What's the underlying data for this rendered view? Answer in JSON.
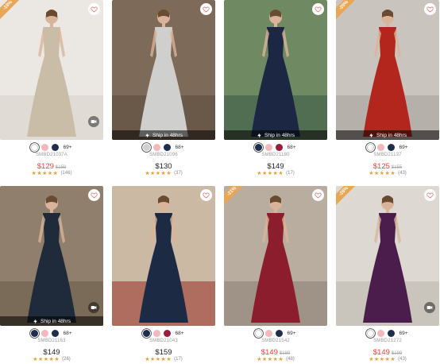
{
  "colors": {
    "sale_price": "#e8453c",
    "star": "#e6a23c",
    "badge": "#e9a657"
  },
  "products": [
    {
      "badge": "-18%",
      "ship_text": "",
      "swatches": [
        "#ffffff",
        "#f3b8bd",
        "#1e2e4d"
      ],
      "more_colors": "69+",
      "code": "SMBD21037A",
      "price": "$129",
      "original_price": "$159",
      "on_sale": true,
      "stars": "★★★★★",
      "reviews": "(146)",
      "has_video": true,
      "scene": {
        "bg": "#ebe8e3",
        "dress": "#c9bda8",
        "bg2": "#d9d4cc"
      }
    },
    {
      "badge": "",
      "ship_text": "Ship in 48hrs",
      "swatches": [
        "#d0d0d0",
        "#f3b8bd",
        "#1e2e4d"
      ],
      "more_colors": "68+",
      "code": "SMBD21096",
      "price": "$130",
      "original_price": "",
      "on_sale": false,
      "stars": "★★★★★",
      "reviews": "(37)",
      "has_video": false,
      "scene": {
        "bg": "#7d6a58",
        "dress": "#cfcfcd",
        "bg2": "#5e4e40"
      }
    },
    {
      "badge": "",
      "ship_text": "Ship in 48hrs",
      "swatches": [
        "#1e2e4d",
        "#f3b8bd",
        "#9b1c3a"
      ],
      "more_colors": "68+",
      "code": "SMBD21180",
      "price": "$149",
      "original_price": "",
      "on_sale": false,
      "stars": "★★★★★",
      "reviews": "(17)",
      "has_video": false,
      "scene": {
        "bg": "#6f8a62",
        "dress": "#1c2743",
        "bg2": "#3f5c48"
      }
    },
    {
      "badge": "-20%",
      "ship_text": "Ship in 48hrs",
      "swatches": [
        "#ffffff",
        "#f3b8bd",
        "#1e2e4d"
      ],
      "more_colors": "69+",
      "code": "SMBD21137",
      "price": "$125",
      "original_price": "$155",
      "on_sale": true,
      "stars": "★★★★★",
      "reviews": "(43)",
      "has_video": false,
      "scene": {
        "bg": "#c9c4bd",
        "dress": "#b2261e",
        "bg2": "#a8a39b"
      }
    },
    {
      "badge": "",
      "ship_text": "Ship in 48hrs",
      "swatches": [
        "#1e2e4d",
        "#f3b8bd",
        "#1e2e4d"
      ],
      "more_colors": "68+",
      "code": "SMBD21163",
      "price": "$149",
      "original_price": "",
      "on_sale": false,
      "stars": "★★★★★",
      "reviews": "(26)",
      "has_video": true,
      "scene": {
        "bg": "#8f7f6c",
        "dress": "#1f2b3a",
        "bg2": "#6c5c4b"
      }
    },
    {
      "badge": "",
      "ship_text": "",
      "swatches": [
        "#1e2e4d",
        "#f3b8bd",
        "#9b1c3a"
      ],
      "more_colors": "68+",
      "code": "SMBD21043",
      "price": "$159",
      "original_price": "",
      "on_sale": false,
      "stars": "★★★★★",
      "reviews": "(17)",
      "has_video": false,
      "scene": {
        "bg": "#cbb9a3",
        "dress": "#1d2a44",
        "bg2": "#9b3a30"
      }
    },
    {
      "badge": "-21%",
      "ship_text": "",
      "swatches": [
        "#ffffff",
        "#f3b8bd",
        "#1e2e4d"
      ],
      "more_colors": "69+",
      "code": "SMBD21542",
      "price": "$149",
      "original_price": "$189",
      "on_sale": true,
      "stars": "★★★★★",
      "reviews": "(48)",
      "has_video": false,
      "scene": {
        "bg": "#b9ada0",
        "dress": "#8b1d2c",
        "bg2": "#8e8276"
      }
    },
    {
      "badge": "-26%",
      "ship_text": "",
      "swatches": [
        "#ffffff",
        "#f3b8bd",
        "#1e2e4d"
      ],
      "more_colors": "69+",
      "code": "SMBD21272",
      "price": "$149",
      "original_price": "$199",
      "on_sale": true,
      "stars": "★★★★★",
      "reviews": "(43)",
      "has_video": true,
      "scene": {
        "bg": "#ddd9d2",
        "dress": "#4a1d4d",
        "bg2": "#bdb7ad"
      }
    }
  ]
}
